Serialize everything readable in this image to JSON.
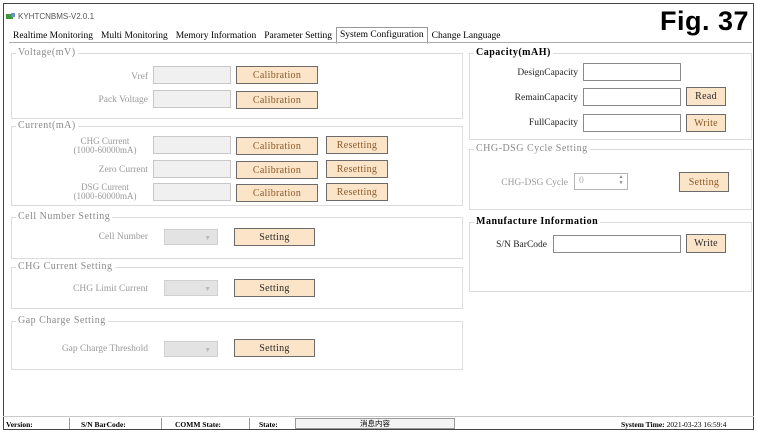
{
  "window": {
    "title": "KYHTCNBMS-V2.0.1",
    "figure_label": "Fig. 37"
  },
  "tabs": [
    {
      "label": "Realtime Monitoring",
      "active": false
    },
    {
      "label": "Multi Monitoring",
      "active": false
    },
    {
      "label": "Memory Information",
      "active": false
    },
    {
      "label": "Parameter Setting",
      "active": false
    },
    {
      "label": "System Configuration",
      "active": true
    },
    {
      "label": "Change Language",
      "active": false
    }
  ],
  "voltage": {
    "title": "Voltage(mV)",
    "vref_label": "Vref",
    "pack_label": "Pack Voltage",
    "calibration_label": "Calibration"
  },
  "current": {
    "title": "Current(mA)",
    "chg_label_1": "CHG Current",
    "chg_label_2": "(1000-60000mA)",
    "zero_label": "Zero Current",
    "dsg_label_1": "DSG Current",
    "dsg_label_2": "(1000-60000mA)",
    "calibration_label": "Calibration",
    "resetting_label": "Resetting"
  },
  "cell_number": {
    "title": "Cell Number Setting",
    "label": "Cell Number",
    "button": "Setting"
  },
  "chg_current": {
    "title": "CHG Current Setting",
    "label": "CHG Limit Current",
    "button": "Setting"
  },
  "gap_charge": {
    "title": "Gap Charge Setting",
    "label": "Gap Charge Threshold",
    "button": "Setting"
  },
  "capacity": {
    "title": "Capacity(mAH)",
    "design_label": "DesignCapacity",
    "remain_label": "RemainCapacity",
    "full_label": "FullCapacity",
    "read_label": "Read",
    "write_label": "Write"
  },
  "cycle": {
    "title": "CHG-DSG Cycle Setting",
    "label": "CHG-DSG Cycle",
    "value": "0",
    "button": "Setting"
  },
  "manufacture": {
    "title": "Manufacture Information",
    "barcode_label": "S/N BarCode",
    "write_label": "Write"
  },
  "status": {
    "version_label": "Version:",
    "barcode_label": "S/N BarCode:",
    "comm_label": "COMM State:",
    "state_label": "State:",
    "state_value": "消息内容",
    "time_label": "System Time:",
    "time_value": "2021-03-23 16:59:4"
  }
}
